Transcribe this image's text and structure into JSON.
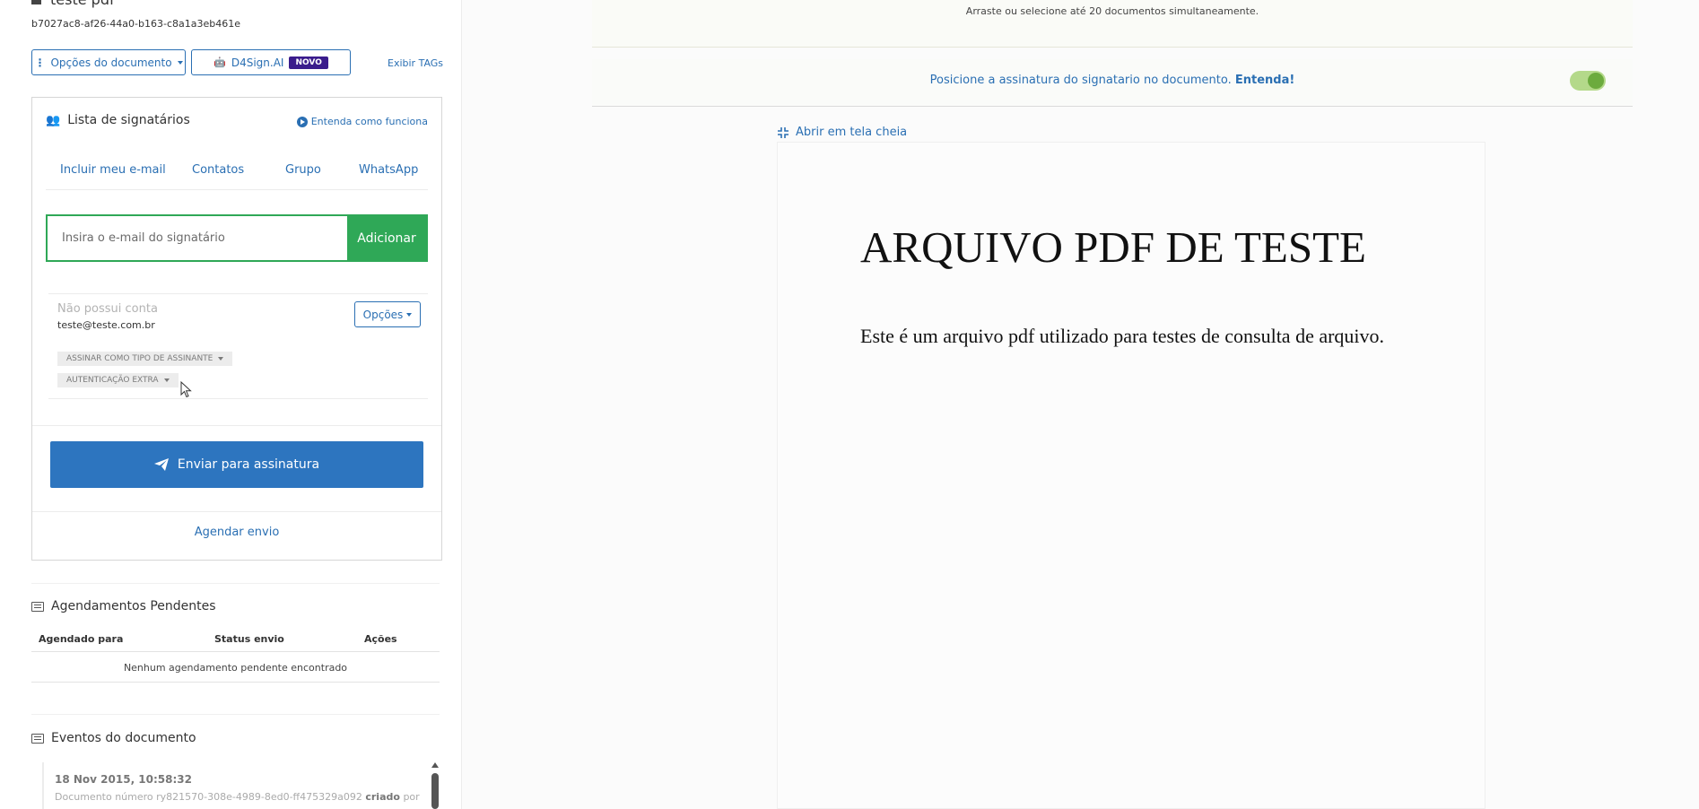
{
  "document": {
    "title": "teste pdf",
    "id": "b7027ac8-af26-44a0-b163-c8a1a3eb461e",
    "options_label": "Opções do documento",
    "ai_label": "D4Sign.AI",
    "ai_badge": "NOVO",
    "show_tags": "Exibir TAGs"
  },
  "signers": {
    "title": "Lista de signatários",
    "help": "Entenda como funciona",
    "tabs": [
      "Incluir meu e-mail",
      "Contatos",
      "Grupo",
      "WhatsApp"
    ],
    "email_placeholder": "Insira o e-mail do signatário",
    "add_label": "Adicionar",
    "entry": {
      "status": "Não possui conta",
      "email": "teste@teste.com.br",
      "options_label": "Opções",
      "sign_type": "ASSINAR COMO TIPO DE ASSINANTE",
      "extra_auth": "AUTENTICAÇÃO EXTRA"
    },
    "send_label": "Enviar para assinatura",
    "schedule_label": "Agendar envio"
  },
  "schedules": {
    "title": "Agendamentos Pendentes",
    "columns": [
      "Agendado para",
      "Status envio",
      "Ações"
    ],
    "empty": "Nenhum agendamento pendente encontrado"
  },
  "events": {
    "title": "Eventos do documento",
    "items": [
      {
        "date": "18 Nov 2015, 10:58:32",
        "text": "Documento número ry821570-308e-4989-8ed0-ff475329a092",
        "action": "criado",
        "suffix": "por"
      }
    ]
  },
  "upload": {
    "hint": "Arraste ou selecione até 20 documentos simultaneamente."
  },
  "positioning": {
    "text": "Posicione a assinatura do signatario no documento.",
    "link": "Entenda!",
    "toggle_on": true
  },
  "viewer": {
    "fullscreen_label": "Abrir em tela cheia",
    "pdf_title": "ARQUIVO PDF DE TESTE",
    "pdf_body": "Este é um arquivo pdf utilizado para testes de consulta de arquivo."
  },
  "colors": {
    "primary": "#2a6fb3",
    "success": "#2fa857",
    "send": "#2d75bf",
    "badge": "#3a1c8c"
  }
}
